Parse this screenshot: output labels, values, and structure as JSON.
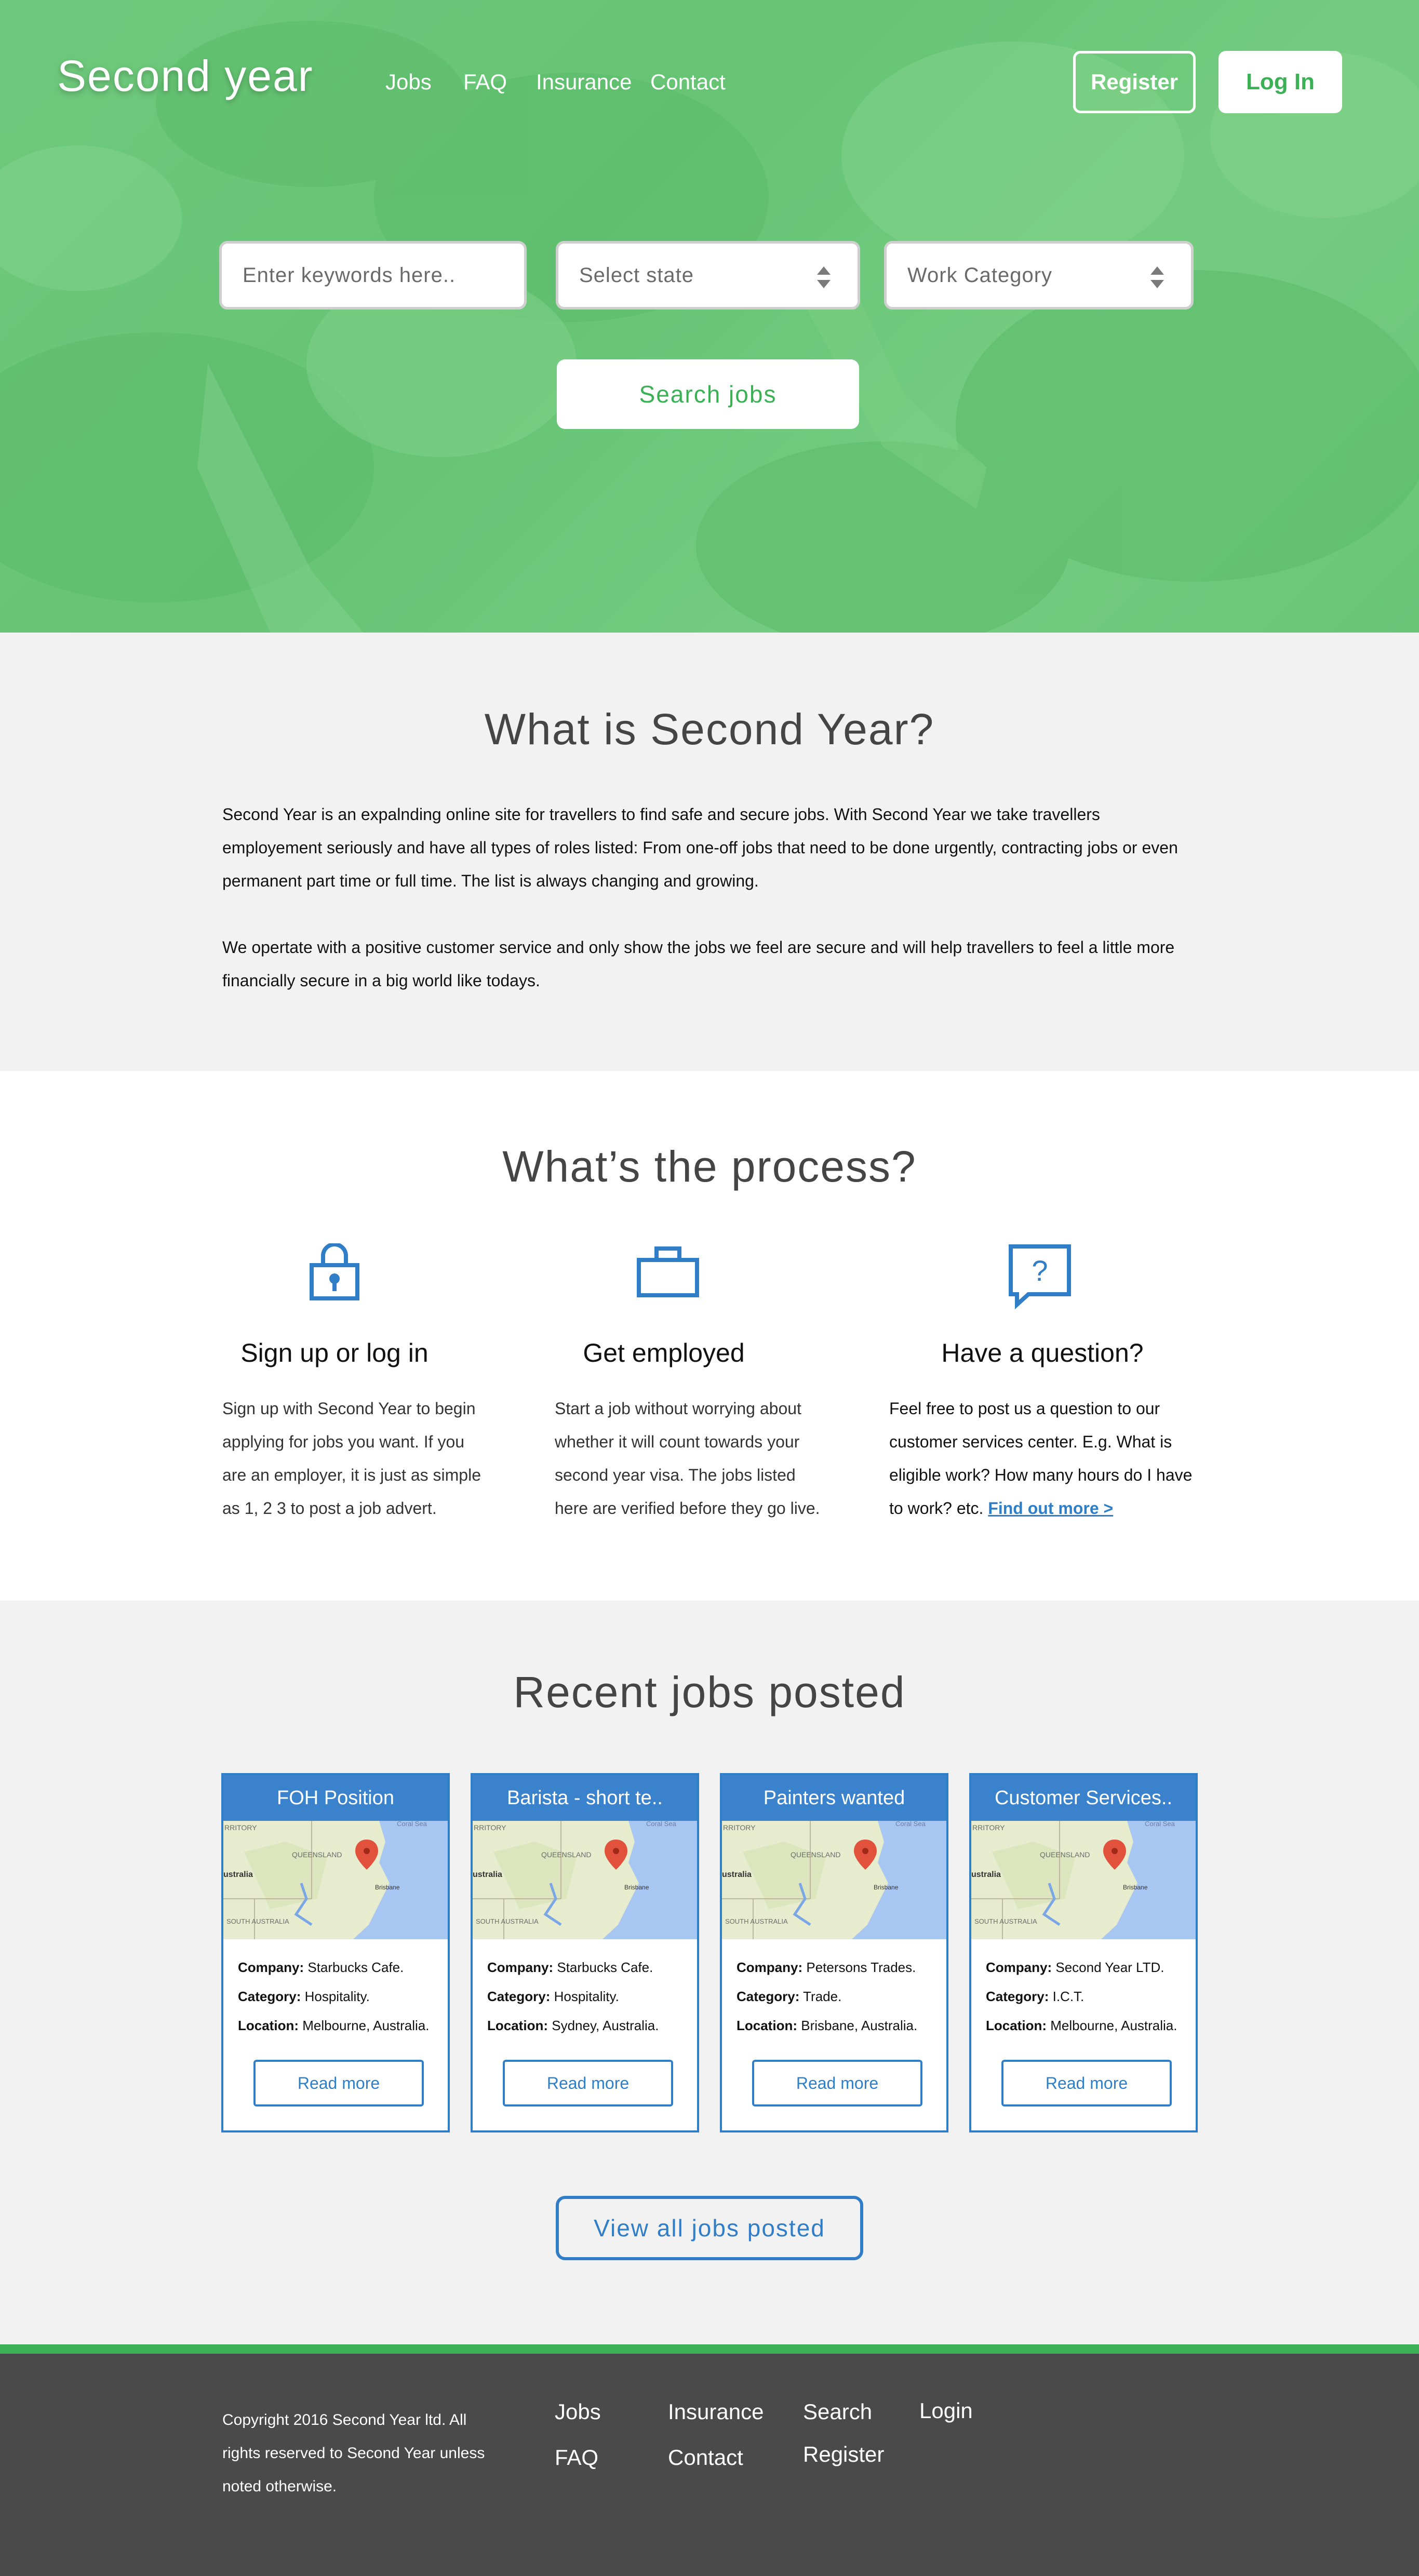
{
  "brand": {
    "logo": "Second year"
  },
  "nav": {
    "jobs": "Jobs",
    "faq": "FAQ",
    "insurance": "Insurance",
    "contact": "Contact"
  },
  "auth": {
    "register": "Register",
    "login": "Log In"
  },
  "search": {
    "keywords_placeholder": "Enter keywords here..",
    "state_placeholder": "Select state",
    "category_placeholder": "Work Category",
    "button": "Search jobs"
  },
  "about": {
    "title": "What is Second Year?",
    "paragraphs": [
      "Second Year is an expalnding online site for travellers to find safe and secure jobs. With Second Year we take travellers employement seriously and have all types of roles listed: From one-off jobs that need to be done urgently, contracting jobs or even permanent part time or full time. The list is always changing and growing.",
      "We opertate with a positive customer service and only show the jobs we feel are secure and will help travellers to feel a little more financially secure in a big world like todays."
    ]
  },
  "process": {
    "title": "What’s the process?",
    "steps": [
      {
        "icon": "lock-icon",
        "title": "Sign up or log in",
        "text": "Sign up with Second Year to begin applying for jobs you want. If you are an employer, it is just as simple as 1, 2 3 to post a job advert."
      },
      {
        "icon": "briefcase-icon",
        "title": "Get employed",
        "text": "Start a job without worrying about whether it will count towards your second year visa. The jobs listed here are verified before they go live."
      },
      {
        "icon": "question-bubble-icon",
        "title": "Have a question?",
        "text": "Feel free to post us a question to our customer services center. E.g. What is eligible work? How many hours do I have to work? etc.",
        "link": "Find out more >"
      }
    ]
  },
  "recent": {
    "title": "Recent jobs posted",
    "labels": {
      "company": "Company:",
      "category": "Category:",
      "location": "Location:"
    },
    "map_labels": {
      "territory": "RRITORY",
      "queensland": "QUEENSLAND",
      "coral_sea": "Coral Sea",
      "australia": "ustralia",
      "south_australia": "SOUTH\nAUSTRALIA",
      "brisbane": "Brisbane"
    },
    "read_more": "Read more",
    "jobs": [
      {
        "title": "FOH Position",
        "company": "Starbucks Cafe.",
        "category": "Hospitality.",
        "location": "Melbourne, Australia."
      },
      {
        "title": "Barista - short te..",
        "company": "Starbucks Cafe.",
        "category": "Hospitality.",
        "location": "Sydney, Australia."
      },
      {
        "title": "Painters wanted",
        "company": "Petersons Trades.",
        "category": "Trade.",
        "location": "Brisbane, Australia."
      },
      {
        "title": "Customer Services..",
        "company": "Second Year LTD.",
        "category": "I.C.T.",
        "location": "Melbourne, Australia."
      }
    ],
    "view_all": "View all jobs posted"
  },
  "footer": {
    "copyright": "Copyright 2016 Second Year ltd. All rights reserved to Second Year unless noted otherwise.",
    "links": {
      "jobs": "Jobs",
      "faq": "FAQ",
      "insurance": "Insurance",
      "contact": "Contact",
      "search": "Search",
      "register": "Register",
      "login": "Login"
    }
  },
  "colors": {
    "brand_green": "#3cb054",
    "accent_blue": "#2f7ec7",
    "footer_bg": "#4a4a4a",
    "section_bg": "#f2f2f2"
  }
}
